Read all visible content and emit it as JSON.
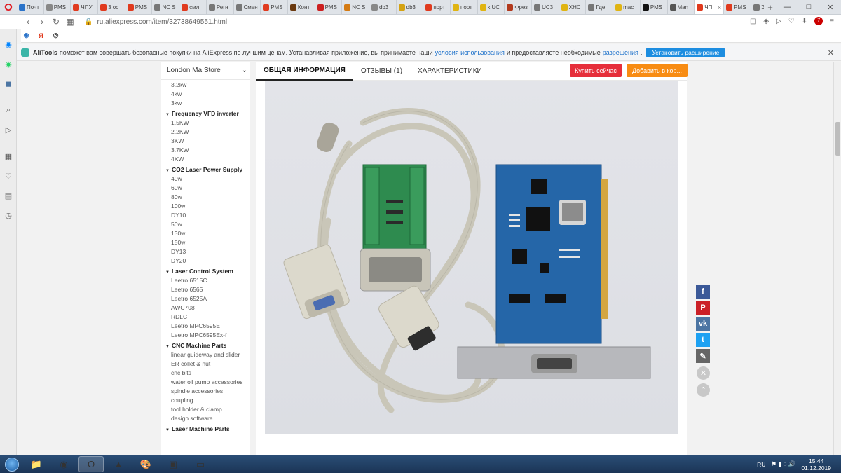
{
  "browser": {
    "tabs": [
      {
        "label": "Почт",
        "color": "#2a73c9"
      },
      {
        "label": "PMS",
        "color": "#888888"
      },
      {
        "label": "ЧПУ",
        "color": "#e03a1e"
      },
      {
        "label": "3 ос",
        "color": "#e03a1e"
      },
      {
        "label": "PMS",
        "color": "#e03a1e"
      },
      {
        "label": "NC S",
        "color": "#777777"
      },
      {
        "label": "смл",
        "color": "#e03a1e"
      },
      {
        "label": "Регн",
        "color": "#777777"
      },
      {
        "label": "Смен",
        "color": "#777777"
      },
      {
        "label": "PMS",
        "color": "#e03a1e"
      },
      {
        "label": "Конт",
        "color": "#6b3a10"
      },
      {
        "label": "PMS",
        "color": "#cc2020"
      },
      {
        "label": "NC S",
        "color": "#d47a12"
      },
      {
        "label": "db3",
        "color": "#888888"
      },
      {
        "label": "db3",
        "color": "#d4a212"
      },
      {
        "label": "порт",
        "color": "#e03a1e"
      },
      {
        "label": "порт",
        "color": "#e0b412"
      },
      {
        "label": "к UC",
        "color": "#e0b412"
      },
      {
        "label": "Фрез",
        "color": "#b23a1e"
      },
      {
        "label": "UC3",
        "color": "#777777"
      },
      {
        "label": "ХНС",
        "color": "#e0b412"
      },
      {
        "label": "Где",
        "color": "#777777"
      },
      {
        "label": "mac",
        "color": "#e0b412"
      },
      {
        "label": "PMS",
        "color": "#111111"
      },
      {
        "label": "Man",
        "color": "#555555"
      },
      {
        "label": "ЧП",
        "color": "#e03a1e",
        "active": true
      },
      {
        "label": "PMS",
        "color": "#e03a1e"
      },
      {
        "label": "Эксп",
        "color": "#777777"
      }
    ],
    "tab_close": "×",
    "tab_plus": "+",
    "win_minimize": "—",
    "win_maximize": "□",
    "win_close": "✕",
    "url": "ru.aliexpress.com/item/32738649551.html",
    "nav_back": "‹",
    "nav_forward": "›",
    "nav_reload": "↻",
    "nav_tabs": "▦",
    "lock": "🔒",
    "addr_badge": "7",
    "bookmarks": [
      {
        "label": "◉",
        "color": "#2a73c9"
      },
      {
        "label": "Я",
        "color": "#e03a1e"
      },
      {
        "label": "◎",
        "color": "#444444"
      }
    ]
  },
  "alitools": {
    "brand": "AliTools",
    "text_before": "поможет вам совершать безопасные покупки на AliExpress по лучшим ценам. Устанавливая приложение, вы принимаете наши",
    "link_terms": "условия использования",
    "text_middle": "и предоставляете необходимые",
    "link_permissions": "разрешения",
    "text_after": ".",
    "install_button": "Установить расширение",
    "close": "✕"
  },
  "store": {
    "name": "London Ma Store",
    "dropdown": "⌄"
  },
  "categories": [
    {
      "header": "",
      "items": [
        "3.2kw",
        "4kw",
        "3kw"
      ]
    },
    {
      "header": "Frequency VFD inverter",
      "items": [
        "1.5KW",
        "2.2KW",
        "3KW",
        "3.7KW",
        "4KW"
      ]
    },
    {
      "header": "CO2 Laser Power Supply",
      "items": [
        "40w",
        "60w",
        "80w",
        "100w",
        "DY10",
        "50w",
        "130w",
        "150w",
        "DY13",
        "DY20"
      ]
    },
    {
      "header": "Laser Control System",
      "items": [
        "Leetro 6515C",
        "Leetro 6565",
        "Leetro 6525A",
        "AWC708",
        "RDLC",
        "Leetro MPC6595E",
        "Leetro MPC6595Ex-f"
      ]
    },
    {
      "header": "CNC Machine Parts",
      "items": [
        "linear guideway and slider",
        "ER collet & nut",
        "cnc bits",
        "water oil pump accessories",
        "spindle accessories",
        "coupling",
        "tool holder & clamp",
        "design software"
      ]
    },
    {
      "header": "Laser Machine Parts",
      "items": []
    }
  ],
  "product_tabs": [
    {
      "label": "ОБЩАЯ ИНФОРМАЦИЯ",
      "active": true
    },
    {
      "label": "ОТЗЫВЫ (1)",
      "active": false
    },
    {
      "label": "ХАРАКТЕРИСТИКИ",
      "active": false
    }
  ],
  "buy_now": "Купить сейчас",
  "add_to_cart": "Добавить в кор...",
  "share": [
    {
      "name": "facebook-share-icon",
      "glyph": "f",
      "color": "#3b5998"
    },
    {
      "name": "pinterest-share-icon",
      "glyph": "P",
      "color": "#cb2027"
    },
    {
      "name": "vk-share-icon",
      "glyph": "vk",
      "color": "#4c75a3"
    },
    {
      "name": "twitter-share-icon",
      "glyph": "t",
      "color": "#1da1f2"
    },
    {
      "name": "edit-icon",
      "glyph": "✎",
      "color": "#666666"
    }
  ],
  "close_round": "✕",
  "scroll_top": "⌃",
  "taskbar": {
    "apps": [
      "📁",
      "◉",
      "O",
      "▲",
      "🎨",
      "▣",
      "▭"
    ],
    "lang": "RU",
    "time": "15:44",
    "date": "01.12.2019"
  }
}
